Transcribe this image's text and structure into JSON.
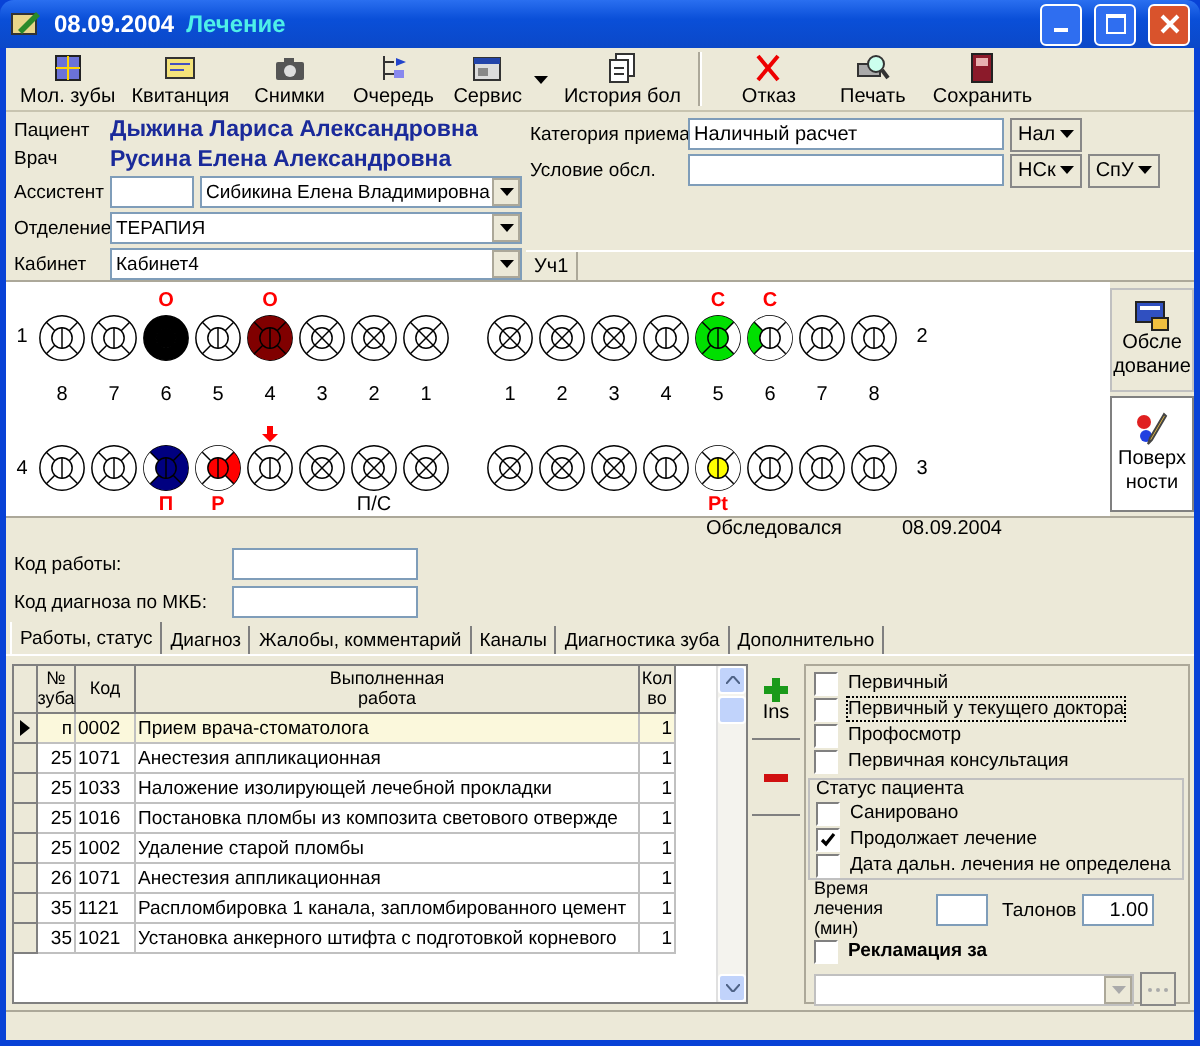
{
  "window": {
    "date": "08.09.2004",
    "title": "Лечение"
  },
  "toolbar": [
    {
      "label": "Мол. зубы",
      "separator_before": false,
      "dropdown": false
    },
    {
      "label": "Квитанция",
      "separator_before": false,
      "dropdown": false
    },
    {
      "label": "Снимки",
      "separator_before": false,
      "dropdown": false
    },
    {
      "label": "Очередь",
      "separator_before": false,
      "dropdown": false
    },
    {
      "label": "Сервис",
      "separator_before": false,
      "dropdown": true
    },
    {
      "label": "История бол",
      "separator_before": false,
      "dropdown": false
    },
    {
      "label": "Отказ",
      "separator_before": true,
      "dropdown": false
    },
    {
      "label": "Печать",
      "separator_before": false,
      "dropdown": false
    },
    {
      "label": "Сохранить",
      "separator_before": false,
      "dropdown": false
    }
  ],
  "form": {
    "patient": {
      "label": "Пациент",
      "value": "Дыжина Лариса Александровна"
    },
    "doctor": {
      "label": "Врач",
      "value": "Русина Елена Александровна"
    },
    "assistant": {
      "label": "Ассистент",
      "value": "Сибикина Елена Владимировна"
    },
    "department": {
      "label": "Отделение",
      "value": "ТЕРАПИЯ"
    },
    "cabinet": {
      "label": "Кабинет",
      "value": "Кабинет4"
    },
    "category": {
      "label": "Категория приема",
      "value": "Наличный расчет",
      "buttons": [
        "Нал"
      ]
    },
    "condition": {
      "label": "Условие обсл.",
      "buttons": [
        "НСк",
        "СпУ"
      ]
    }
  },
  "section_tab": "Уч1",
  "jaw": {
    "quadrant_labels": [
      "1",
      "2",
      "4",
      "3"
    ],
    "numbers": [
      "8",
      "7",
      "6",
      "5",
      "4",
      "3",
      "2",
      "1",
      "1",
      "2",
      "3",
      "4",
      "5",
      "6",
      "7",
      "8"
    ],
    "upper": [
      {
        "kind": "molar"
      },
      {
        "kind": "molar"
      },
      {
        "kind": "molar",
        "mark": "О",
        "color": "#000000",
        "surfaces": {
          "top": true,
          "right": true,
          "bottom": true,
          "left": true,
          "center": true
        }
      },
      {
        "kind": "molar"
      },
      {
        "kind": "molar",
        "mark": "О",
        "color": "#800000",
        "surfaces": {
          "top": true,
          "right": true,
          "bottom": true,
          "left": true,
          "center": true
        }
      },
      {
        "kind": "front"
      },
      {
        "kind": "front"
      },
      {
        "kind": "front"
      },
      {
        "kind": "front"
      },
      {
        "kind": "front"
      },
      {
        "kind": "front"
      },
      {
        "kind": "molar"
      },
      {
        "kind": "molar",
        "mark": "С",
        "color": "#00e000",
        "surfaces": {
          "top": true,
          "right": false,
          "bottom": true,
          "left": true,
          "center": true
        }
      },
      {
        "kind": "molar",
        "mark": "С",
        "color": "#00e000",
        "surfaces": {
          "top": false,
          "right": false,
          "bottom": false,
          "left": true,
          "center": false
        }
      },
      {
        "kind": "molar"
      },
      {
        "kind": "molar"
      }
    ],
    "lower": [
      {
        "kind": "molar",
        "arrow": false
      },
      {
        "kind": "molar",
        "arrow": false
      },
      {
        "kind": "molar",
        "arrow": false,
        "mark": "П",
        "color": "#000080",
        "surfaces": {
          "top": true,
          "right": true,
          "bottom": true,
          "left": false,
          "center": true
        }
      },
      {
        "kind": "molar",
        "arrow": false,
        "mark": "Р",
        "color": "#ff0000",
        "surfaces": {
          "top": false,
          "right": true,
          "bottom": false,
          "left": false,
          "center": true
        }
      },
      {
        "kind": "molar",
        "arrow": true
      },
      {
        "kind": "front",
        "arrow": false
      },
      {
        "kind": "front",
        "arrow": false,
        "mark": "П/С"
      },
      {
        "kind": "front",
        "arrow": false
      },
      {
        "kind": "front",
        "arrow": false
      },
      {
        "kind": "front",
        "arrow": false
      },
      {
        "kind": "front",
        "arrow": false
      },
      {
        "kind": "molar",
        "arrow": false
      },
      {
        "kind": "molar",
        "arrow": false,
        "mark": "Pt",
        "color": "#ffff00",
        "surfaces": {
          "top": false,
          "right": false,
          "bottom": false,
          "left": false,
          "center": true
        }
      },
      {
        "kind": "molar",
        "arrow": false
      },
      {
        "kind": "molar",
        "arrow": false
      },
      {
        "kind": "molar",
        "arrow": false
      }
    ]
  },
  "side_buttons": [
    {
      "label": "Обсле дование",
      "selected": false
    },
    {
      "label": "Поверх ности",
      "selected": true
    }
  ],
  "exam": {
    "label": "Обследовался",
    "date": "08.09.2004"
  },
  "code_fields": [
    {
      "label": "Код работы:"
    },
    {
      "label": "Код диагноза по МКБ:"
    }
  ],
  "tabs": [
    {
      "label": "Работы, статус",
      "selected": true
    },
    {
      "label": "Диагноз",
      "selected": false
    },
    {
      "label": "Жалобы,  комментарий",
      "selected": false
    },
    {
      "label": "Каналы",
      "selected": false
    },
    {
      "label": "Диагностика зуба",
      "selected": false
    },
    {
      "label": "Дополнительно",
      "selected": false
    }
  ],
  "table": {
    "columns": [
      "№ зуба",
      "Код",
      "Выполненная\nработа",
      "Кол во"
    ],
    "rows": [
      {
        "tooth": "п",
        "code": "0002",
        "work": "Прием врача-стоматолога",
        "qty": "1",
        "selected": true
      },
      {
        "tooth": "25",
        "code": "1071",
        "work": "Анестезия  аппликационная",
        "qty": "1",
        "selected": false
      },
      {
        "tooth": "25",
        "code": "1033",
        "work": "Наложение изолирующей лечебной прокладки",
        "qty": "1",
        "selected": false
      },
      {
        "tooth": "25",
        "code": "1016",
        "work": "Постановка пломбы из композита светового отверждe",
        "qty": "1",
        "selected": false
      },
      {
        "tooth": "25",
        "code": "1002",
        "work": "Удаление старой пломбы",
        "qty": "1",
        "selected": false
      },
      {
        "tooth": "26",
        "code": "1071",
        "work": "Анестезия  аппликационная",
        "qty": "1",
        "selected": false
      },
      {
        "tooth": "35",
        "code": "1121",
        "work": "Распломбировка 1 канала, запломбированного цемент",
        "qty": "1",
        "selected": false
      },
      {
        "tooth": "35",
        "code": "1021",
        "work": "Установка анкерного штифта с подготовкой корневого",
        "qty": "1",
        "selected": false
      }
    ]
  },
  "row_buttons": [
    {
      "kind": "add",
      "label": "Ins"
    },
    {
      "kind": "remove"
    }
  ],
  "visit_checks": [
    {
      "label": "Первичный",
      "checked": false,
      "focused": false
    },
    {
      "label": "Первичный у текущего доктора",
      "checked": false,
      "focused": true
    },
    {
      "label": "Профосмотр",
      "checked": false,
      "focused": false
    },
    {
      "label": "Первичная консультация",
      "checked": false,
      "focused": false
    }
  ],
  "patient_status": {
    "title": "Статус пациента",
    "items": [
      {
        "label": "Санировано",
        "checked": false
      },
      {
        "label": "Продолжает лечение",
        "checked": true
      },
      {
        "label": "Дата дальн. лечения не определена",
        "checked": false
      }
    ]
  },
  "treatment_time": {
    "label": "Время лечения (мин)"
  },
  "talons": {
    "label": "Талонов",
    "value": "1.00"
  },
  "reclamation": {
    "label": "Рекламация за",
    "checked": false
  }
}
